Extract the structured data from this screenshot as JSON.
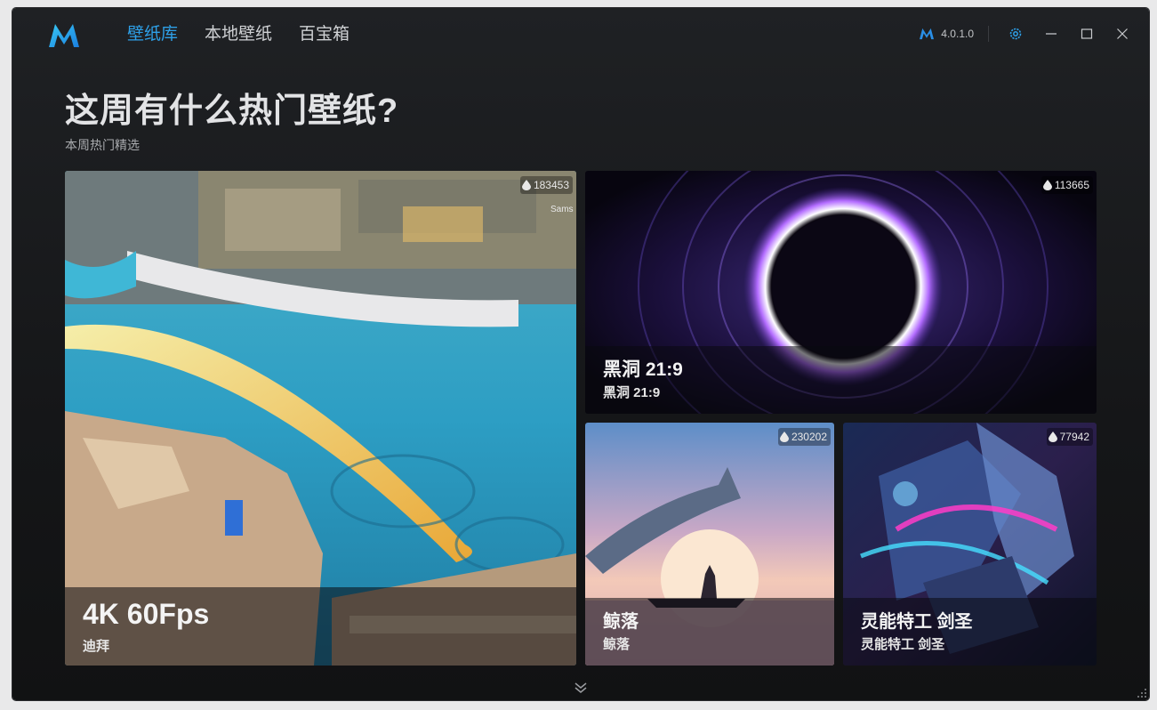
{
  "app": {
    "version": "4.0.1.0",
    "accent": "#2ea0e8"
  },
  "nav": {
    "items": [
      {
        "label": "壁纸库",
        "active": true
      },
      {
        "label": "本地壁纸",
        "active": false
      },
      {
        "label": "百宝箱",
        "active": false
      }
    ]
  },
  "window_controls": {
    "settings_icon": "gear-icon",
    "minimize_icon": "minimize-icon",
    "maximize_icon": "maximize-icon",
    "close_icon": "close-icon"
  },
  "page": {
    "headline": "这周有什么热门壁纸?",
    "subheadline": "本周热门精选"
  },
  "cards": [
    {
      "title": "4K 60Fps",
      "subtitle": "迪拜",
      "count": "183453",
      "watermark": "Sams"
    },
    {
      "title": "黑洞 21:9",
      "subtitle": "黑洞 21:9",
      "count": "113665"
    },
    {
      "title": "鲸落",
      "subtitle": "鲸落",
      "count": "230202"
    },
    {
      "title": "灵能特工 剑圣",
      "subtitle": "灵能特工 剑圣",
      "count": "77942"
    }
  ],
  "footer": {
    "more_icon": "double-chevron-down-icon",
    "resize_icon": "resize-grip-icon"
  }
}
